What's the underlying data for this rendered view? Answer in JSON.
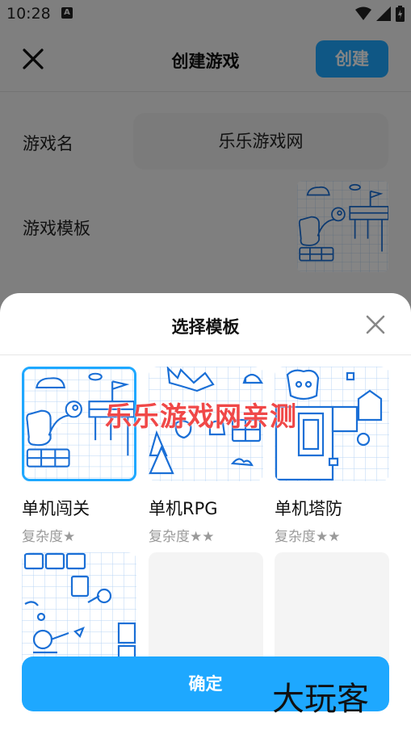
{
  "status_bar": {
    "time": "10:28",
    "notification_icon": "A",
    "icons": [
      "wifi-icon",
      "signal-icon",
      "battery-icon"
    ]
  },
  "app_bar": {
    "title": "创建游戏",
    "create_label": "创建",
    "close_icon": "close-icon"
  },
  "form": {
    "name_label": "游戏名",
    "name_value": "乐乐游戏网",
    "template_label": "游戏模板"
  },
  "sheet": {
    "title": "选择模板",
    "close_icon": "close-icon",
    "templates": [
      {
        "name": "单机闯关",
        "meta": "复杂度★",
        "selected": true
      },
      {
        "name": "单机RPG",
        "meta": "复杂度★★",
        "selected": false
      },
      {
        "name": "单机塔防",
        "meta": "复杂度★★",
        "selected": false
      }
    ],
    "confirm_label": "确定"
  },
  "overlay": {
    "watermark": "乐乐游戏网亲测",
    "brand": "大玩客"
  },
  "colors": {
    "accent": "#1ea8ff",
    "sketch": "#1a6fd6",
    "watermark": "#f04848"
  }
}
